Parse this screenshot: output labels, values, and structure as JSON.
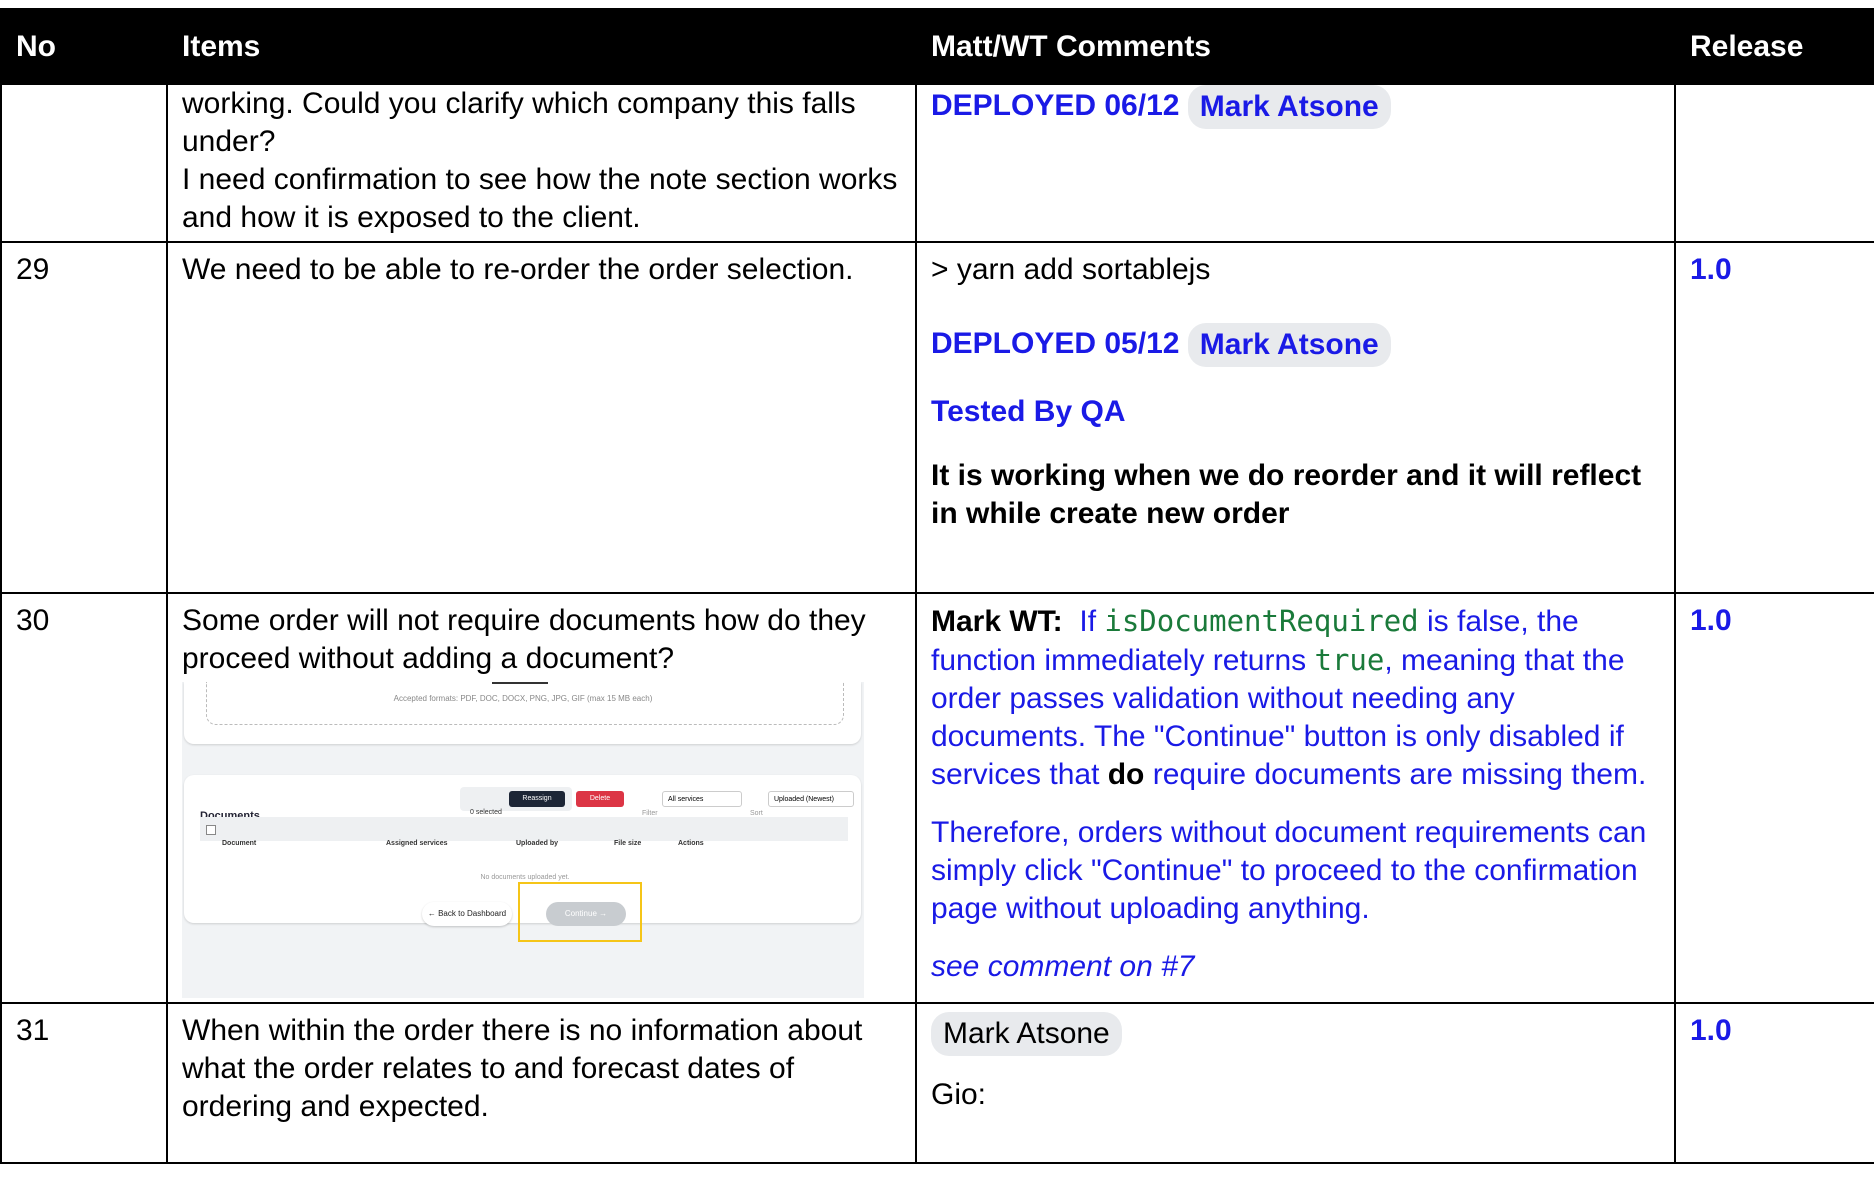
{
  "headers": {
    "no": "No",
    "items": "Items",
    "comments": "Matt/WT Comments",
    "release": "Release"
  },
  "row_prev": {
    "items_lines": [
      "working. Could you clarify which company this falls under?",
      "I need confirmation to see how the note section works and how it is exposed to the client."
    ],
    "deployed": "DEPLOYED 06/12",
    "person_chip": "Mark Atsone"
  },
  "row29": {
    "no": "29",
    "item": "We need to be able to re-order the order selection.",
    "cmd": "> yarn add sortablejs",
    "deployed": "DEPLOYED 05/12",
    "person_chip": "Mark Atsone",
    "tested": "Tested By QA",
    "note": "It is working when we do reorder and it will reflect in while create new order",
    "release": "1.0"
  },
  "row30": {
    "no": "30",
    "item": "Some order will not require documents how do they proceed without adding a document?",
    "author": "Mark WT:",
    "c_part1": "If ",
    "c_code1": "isDocumentRequired",
    "c_part2": " is false, the function immediately returns ",
    "c_code2": "true",
    "c_part3": ", meaning that the order passes validation without needing any documents. The \"Continue\" button is only disabled if services that ",
    "c_bold": "do",
    "c_part4": " require documents are missing them.",
    "para2": "Therefore, orders without document requirements can simply click \"Continue\" to proceed to the confirmation page without uploading anything.",
    "see": "see comment on #7",
    "release": "1.0",
    "screenshot": {
      "accepted": "Accepted formats: PDF, DOC, DOCX, PNG, JPG, GIF (max 15 MB each)",
      "title": "Documents",
      "selected": "0 selected",
      "reassign": "Reassign",
      "delete": "Delete",
      "filter_label": "Filter",
      "filter_value": "All services",
      "sort_label": "Sort",
      "sort_value": "Uploaded (Newest)",
      "col_document": "Document",
      "col_services": "Assigned services",
      "col_uploaded": "Uploaded by",
      "col_size": "File size",
      "col_actions": "Actions",
      "empty": "No documents uploaded yet.",
      "back": "← Back to Dashboard",
      "continue": "Continue →"
    }
  },
  "row31": {
    "no": "31",
    "item": "When within the order there is no information about what the order relates to and forecast dates of ordering and expected.",
    "person_chip": "Mark Atsone",
    "gio": "Gio:",
    "release": "1.0"
  }
}
